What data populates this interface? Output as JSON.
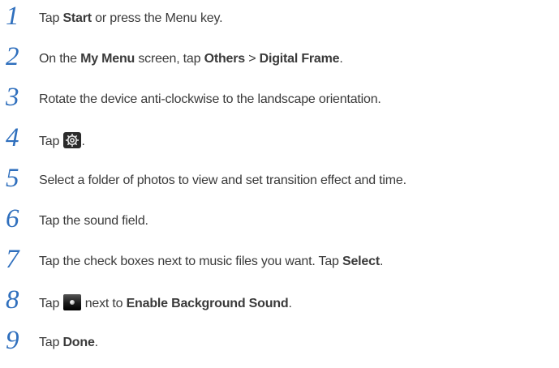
{
  "colors": {
    "step_number": "#2f6fbd",
    "body_text": "#3a3a3a"
  },
  "steps": [
    {
      "number": "1",
      "parts": {
        "a": "Tap ",
        "b": "Start",
        "c": " or press the Menu key."
      }
    },
    {
      "number": "2",
      "parts": {
        "a": "On the ",
        "b": "My Menu",
        "c": " screen, tap ",
        "d": "Others",
        "e": " > ",
        "f": "Digital Frame",
        "g": "."
      }
    },
    {
      "number": "3",
      "parts": {
        "a": "Rotate the device anti-clockwise to the landscape orientation."
      }
    },
    {
      "number": "4",
      "parts": {
        "a": "Tap ",
        "icon": "settings-gear-icon",
        "c": "."
      }
    },
    {
      "number": "5",
      "parts": {
        "a": "Select a folder of photos to view and set transition effect and time."
      }
    },
    {
      "number": "6",
      "parts": {
        "a": "Tap the sound field."
      }
    },
    {
      "number": "7",
      "parts": {
        "a": "Tap the check boxes next to music files you want. Tap ",
        "b": "Select",
        "c": "."
      }
    },
    {
      "number": "8",
      "parts": {
        "a": "Tap ",
        "icon": "toggle-switch-icon",
        "b": " next to ",
        "c": "Enable Background Sound",
        "d": "."
      }
    },
    {
      "number": "9",
      "parts": {
        "a": "Tap ",
        "b": "Done",
        "c": "."
      }
    }
  ]
}
